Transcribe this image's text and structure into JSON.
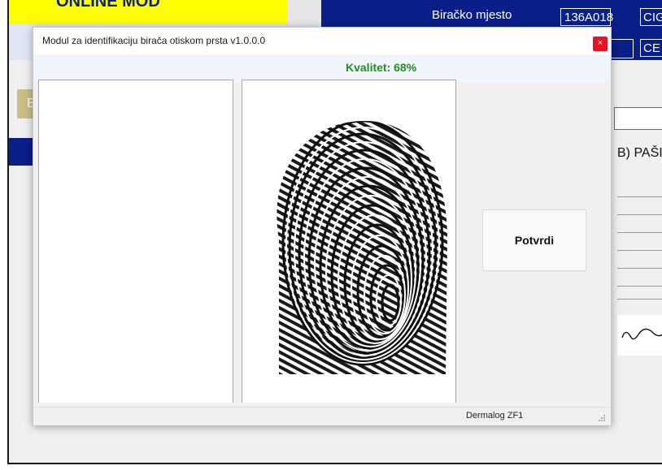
{
  "background_app": {
    "mode_label": "ONLINE MOD",
    "polling_station_label": "Biračko mjesto",
    "polling_station_value": "136A018",
    "field_top_right": "CIG",
    "field_second_right": "CE",
    "side_button_label": "B",
    "voter_name_fragment": "B) PAŠI("
  },
  "dialog": {
    "title": "Modul za identifikaciju birača otiskom prsta v1.0.0.0",
    "close_label": "×",
    "quality_text": "Kvalitet: 68%",
    "confirm_label": "Potvrdi",
    "status_text": "Dermalog ZF1"
  },
  "colors": {
    "app_blue": "#0a1f8a",
    "mode_yellow": "#ffff00",
    "quality_green": "#1f8f1f",
    "close_red": "#e81123"
  }
}
